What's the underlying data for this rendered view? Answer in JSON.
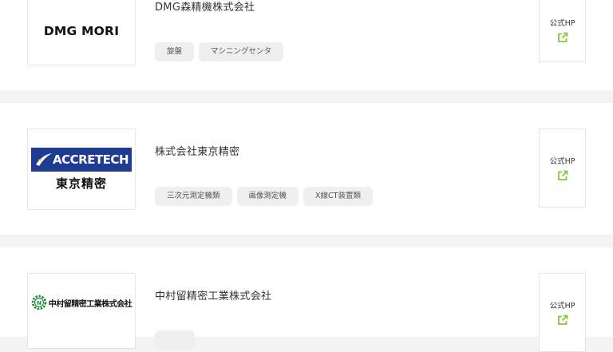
{
  "companies": [
    {
      "logo_text": "DMG MORI",
      "name": "DMG森精機株式会社",
      "tags": [
        "旋盤",
        "マシニングセンタ"
      ],
      "hp_label": "公式HP"
    },
    {
      "logo_text": "ACCRETECH",
      "logo_sub": "東京精密",
      "name": "株式会社東京精密",
      "tags": [
        "三次元測定機類",
        "画像測定機",
        "X線CT装置類"
      ],
      "hp_label": "公式HP"
    },
    {
      "logo_text": "中村留精密工業株式会社",
      "name": "中村留精密工業株式会社",
      "tags": [],
      "hp_label": "公式HP"
    }
  ],
  "colors": {
    "accent": "#8cc63f",
    "background": "#f3f3f3",
    "card": "#ffffff",
    "tag_bg": "#efefef",
    "accretech_blue": "#1f3b94",
    "nakamura_green": "#1a8a3a"
  },
  "icons": {
    "external_link": "external-link-icon"
  }
}
